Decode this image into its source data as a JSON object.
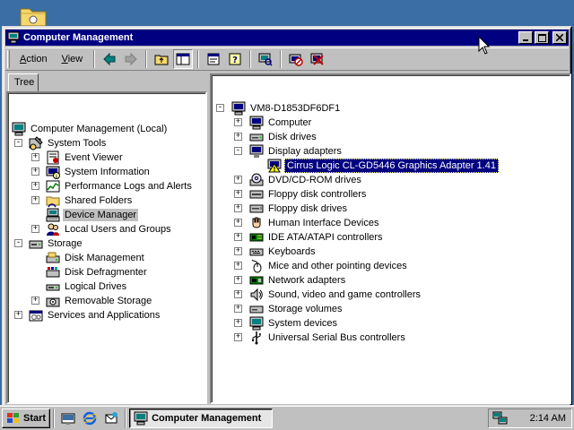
{
  "window": {
    "title": "Computer Management"
  },
  "menu": {
    "action_pre": "",
    "action_ul": "A",
    "action_post": "ction",
    "view_pre": "",
    "view_ul": "V",
    "view_post": "iew"
  },
  "left_tab": "Tree",
  "tree": [
    {
      "label": "Computer Management (Local)",
      "icon": "computer-management-icon",
      "expander": "",
      "depth": 0
    },
    {
      "label": "System Tools",
      "icon": "system-tools-icon",
      "expander": "-",
      "depth": 1
    },
    {
      "label": "Event Viewer",
      "icon": "event-viewer-icon",
      "expander": "+",
      "depth": 2
    },
    {
      "label": "System Information",
      "icon": "system-information-icon",
      "expander": "+",
      "depth": 2
    },
    {
      "label": "Performance Logs and Alerts",
      "icon": "performance-logs-icon",
      "expander": "+",
      "depth": 2
    },
    {
      "label": "Shared Folders",
      "icon": "shared-folders-icon",
      "expander": "+",
      "depth": 2
    },
    {
      "label": "Device Manager",
      "icon": "device-manager-icon",
      "expander": "",
      "depth": 2,
      "selected": true
    },
    {
      "label": "Local Users and Groups",
      "icon": "local-users-icon",
      "expander": "+",
      "depth": 2
    },
    {
      "label": "Storage",
      "icon": "storage-icon",
      "expander": "-",
      "depth": 1
    },
    {
      "label": "Disk Management",
      "icon": "disk-management-icon",
      "expander": "",
      "depth": 2
    },
    {
      "label": "Disk Defragmenter",
      "icon": "disk-defragmenter-icon",
      "expander": "",
      "depth": 2
    },
    {
      "label": "Logical Drives",
      "icon": "logical-drives-icon",
      "expander": "",
      "depth": 2
    },
    {
      "label": "Removable Storage",
      "icon": "removable-storage-icon",
      "expander": "+",
      "depth": 2
    },
    {
      "label": "Services and Applications",
      "icon": "services-applications-icon",
      "expander": "+",
      "depth": 1
    }
  ],
  "devices": [
    {
      "label": "VM8-D1853DF6DF1",
      "icon": "computer-icon",
      "expander": "-",
      "depth": 0
    },
    {
      "label": "Computer",
      "icon": "computer-icon",
      "expander": "+",
      "depth": 1
    },
    {
      "label": "Disk drives",
      "icon": "disk-drive-icon",
      "expander": "+",
      "depth": 1
    },
    {
      "label": "Display adapters",
      "icon": "display-adapter-icon",
      "expander": "-",
      "depth": 1
    },
    {
      "label": "Cirrus Logic CL-GD5446 Graphics Adapter 1.41",
      "icon": "warning-adapter-icon",
      "expander": "",
      "depth": 2,
      "selected": true
    },
    {
      "label": "DVD/CD-ROM drives",
      "icon": "cdrom-icon",
      "expander": "+",
      "depth": 1
    },
    {
      "label": "Floppy disk controllers",
      "icon": "floppy-controller-icon",
      "expander": "+",
      "depth": 1
    },
    {
      "label": "Floppy disk drives",
      "icon": "floppy-drive-icon",
      "expander": "+",
      "depth": 1
    },
    {
      "label": "Human Interface Devices",
      "icon": "hid-icon",
      "expander": "+",
      "depth": 1
    },
    {
      "label": "IDE ATA/ATAPI controllers",
      "icon": "ide-controller-icon",
      "expander": "+",
      "depth": 1
    },
    {
      "label": "Keyboards",
      "icon": "keyboard-icon",
      "expander": "+",
      "depth": 1
    },
    {
      "label": "Mice and other pointing devices",
      "icon": "mouse-icon",
      "expander": "+",
      "depth": 1
    },
    {
      "label": "Network adapters",
      "icon": "network-adapter-icon",
      "expander": "+",
      "depth": 1
    },
    {
      "label": "Sound, video and game controllers",
      "icon": "sound-icon",
      "expander": "+",
      "depth": 1
    },
    {
      "label": "Storage volumes",
      "icon": "storage-volume-icon",
      "expander": "+",
      "depth": 1
    },
    {
      "label": "System devices",
      "icon": "system-devices-icon",
      "expander": "+",
      "depth": 1
    },
    {
      "label": "Universal Serial Bus controllers",
      "icon": "usb-icon",
      "expander": "+",
      "depth": 1
    }
  ],
  "taskbar": {
    "start_label": "Start",
    "task_label": "Computer Management",
    "clock": "2:14 AM"
  },
  "colors": {
    "desktop": "#3a6ea5",
    "titlebar": "#000080",
    "face": "#c0c0c0",
    "selection": "#000080"
  }
}
